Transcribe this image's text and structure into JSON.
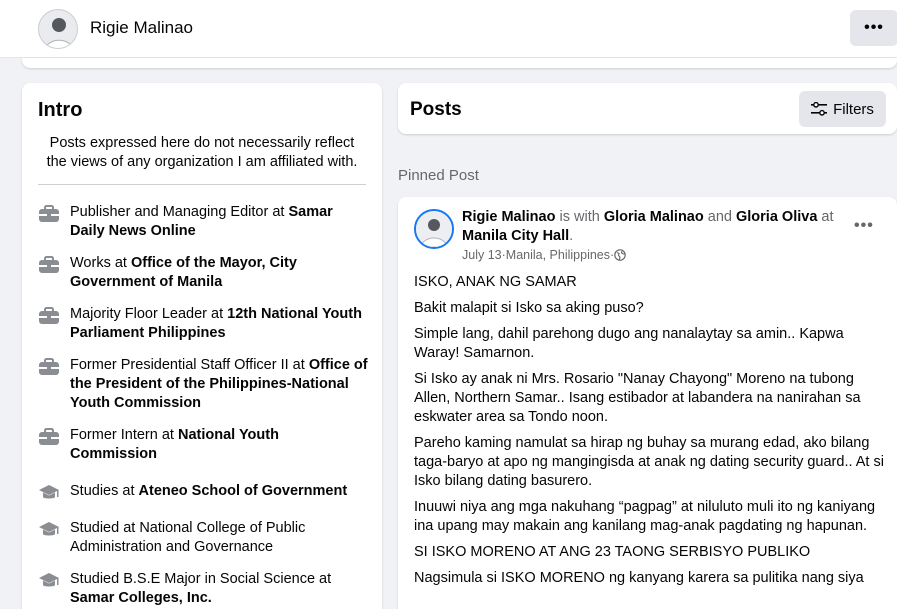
{
  "header": {
    "profile_name": "Rigie Malinao",
    "more_label": "•••"
  },
  "intro": {
    "title": "Intro",
    "bio": "Posts expressed here do not necessarily reflect the views of any organization I am affiliated with.",
    "items": [
      {
        "icon": "briefcase-icon",
        "prefix": "Publisher and Managing Editor at ",
        "org": "Samar Daily News Online"
      },
      {
        "icon": "briefcase-icon",
        "prefix": "Works at ",
        "org": "Office of the Mayor, City Government of Manila"
      },
      {
        "icon": "briefcase-icon",
        "prefix": "Majority Floor Leader at ",
        "org": "12th National Youth Parliament Philippines"
      },
      {
        "icon": "briefcase-icon",
        "prefix": "Former Presidential Staff Officer II at ",
        "org": "Office of the President of the Philippines-National Youth Commission"
      },
      {
        "icon": "briefcase-icon",
        "prefix": "Former Intern at ",
        "org": "National Youth Commission"
      },
      {
        "icon": "graduation-cap-icon",
        "prefix": "Studies at ",
        "org": "Ateneo School of Government"
      },
      {
        "icon": "graduation-cap-icon",
        "prefix": "Studied at National College of Public Administration and Governance",
        "org": ""
      },
      {
        "icon": "graduation-cap-icon",
        "prefix": "Studied B.S.E Major in Social Science at ",
        "org": "Samar Colleges, Inc."
      }
    ]
  },
  "posts": {
    "title": "Posts",
    "filters_label": "Filters",
    "pinned_label": "Pinned Post"
  },
  "post": {
    "author": "Rigie Malinao",
    "with_text": " is with ",
    "tag1": "Gloria Malinao",
    "and_text": " and ",
    "tag2": "Gloria Oliva",
    "at_text": " at ",
    "place": "Manila City Hall",
    "period": ".",
    "date": "July 13",
    "location": "Manila, Philippines",
    "sep": " · ",
    "more_label": "•••",
    "paragraphs": [
      "ISKO, ANAK NG SAMAR",
      "Bakit malapit si Isko sa aking puso?",
      "Simple lang, dahil parehong dugo ang nanalaytay sa amin.. Kapwa Waray! Samarnon.",
      "Si Isko ay anak ni Mrs. Rosario \"Nanay Chayong\" Moreno na tubong Allen, Northern Samar.. Isang estibador at labandera na nanirahan sa eskwater area sa Tondo noon.",
      "Pareho kaming namulat sa hirap ng buhay sa murang edad, ako bilang taga-baryo at apo ng mangingisda at anak ng dating security guard.. At si Isko bilang dating basurero.",
      "Inuuwi niya ang mga nakuhang “pagpag” at niluluto muli ito ng kaniyang ina upang may makain ang kanilang mag-anak pagdating ng hapunan.",
      "SI ISKO MORENO AT ANG 23 TAONG SERBISYO PUBLIKO",
      "Nagsimula si ISKO MORENO ng kanyang karera sa pulitika nang siya"
    ]
  },
  "colors": {
    "background": "#f0f2f5",
    "card": "#ffffff",
    "secondary_text": "#65676b",
    "button_bg": "#e4e6eb",
    "accent": "#1877f2"
  }
}
